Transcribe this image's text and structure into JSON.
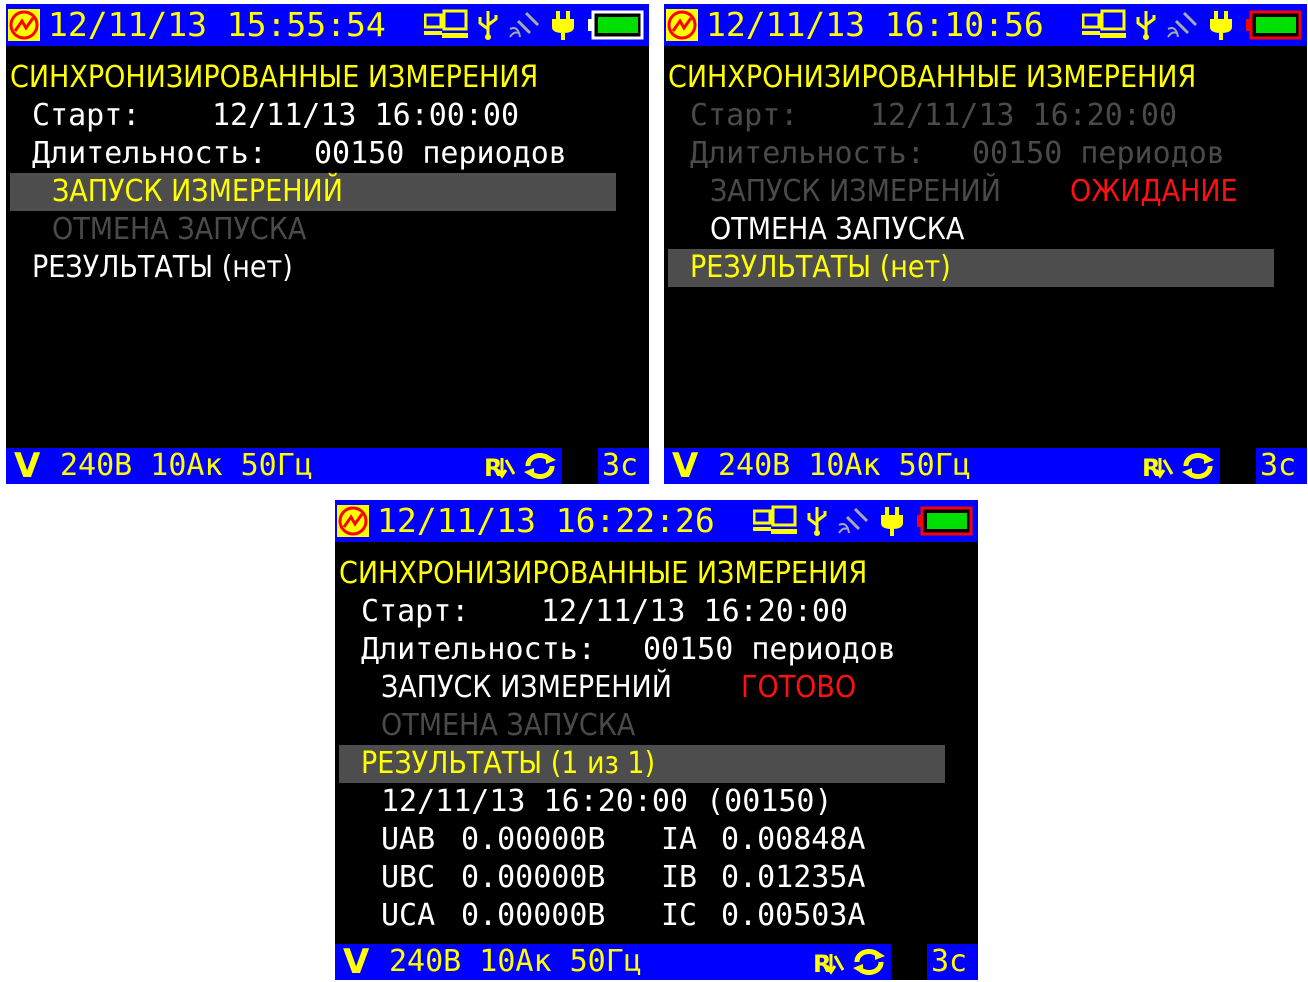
{
  "screens": [
    {
      "datetime": "12/11/13 15:55:54",
      "title": "СИНХРОНИЗИРОВАННЫЕ ИЗМЕРЕНИЯ",
      "start_label": "Старт:",
      "start_value": "12/11/13 16:00:00",
      "duration_label": "Длительность:",
      "duration_value": "00150 периодов",
      "launch_label": "ЗАПУСК ИЗМЕРЕНИЙ",
      "launch_status": "",
      "cancel_label": "ОТМЕНА ЗАПУСКА",
      "results_label": "РЕЗУЛЬТАТЫ (нет)",
      "bottom": {
        "info": "240В 10Ак 50Гц",
        "time": "3с"
      }
    },
    {
      "datetime": "12/11/13 16:10:56",
      "title": "СИНХРОНИЗИРОВАННЫЕ ИЗМЕРЕНИЯ",
      "start_label": "Старт:",
      "start_value": "12/11/13 16:20:00",
      "duration_label": "Длительность:",
      "duration_value": "00150 периодов",
      "launch_label": "ЗАПУСК ИЗМЕРЕНИЙ",
      "launch_status": "ОЖИДАНИЕ",
      "cancel_label": "ОТМЕНА ЗАПУСКА",
      "results_label": "РЕЗУЛЬТАТЫ (нет)",
      "bottom": {
        "info": "240В 10Ак 50Гц",
        "time": "3с"
      }
    },
    {
      "datetime": "12/11/13 16:22:26",
      "title": "СИНХРОНИЗИРОВАННЫЕ ИЗМЕРЕНИЯ",
      "start_label": "Старт:",
      "start_value": "12/11/13 16:20:00",
      "duration_label": "Длительность:",
      "duration_value": "00150 периодов",
      "launch_label": "ЗАПУСК ИЗМЕРЕНИЙ",
      "launch_status": "ГОТОВО",
      "cancel_label": "ОТМЕНА ЗАПУСКА",
      "results_label": "РЕЗУЛЬТАТЫ (1 из 1)",
      "result_header": "12/11/13 16:20:00 (00150)",
      "measurements": [
        {
          "u_label": "UAB",
          "u_value": "0.00000В",
          "i_label": "IA",
          "i_value": "0.00848А"
        },
        {
          "u_label": "UBC",
          "u_value": "0.00000В",
          "i_label": "IB",
          "i_value": "0.01235А"
        },
        {
          "u_label": "UCA",
          "u_value": "0.00000В",
          "i_label": "IC",
          "i_value": "0.00503А"
        }
      ],
      "bottom": {
        "info": "240В 10Ак 50Гц",
        "time": "3с"
      }
    }
  ],
  "icons": [
    "logo-icon",
    "computer-icon",
    "usb-icon",
    "satellite-icon",
    "power-plug-icon",
    "battery-icon",
    "rdl-icon",
    "refresh-icon"
  ],
  "colors": {
    "bar_blue": "#0000ff",
    "text_yellow": "#ffff00",
    "status_red": "#ff1010",
    "battery_green": "#00e000",
    "selection_gray": "#4d4d4d",
    "disabled_gray": "#4a4a4a"
  }
}
